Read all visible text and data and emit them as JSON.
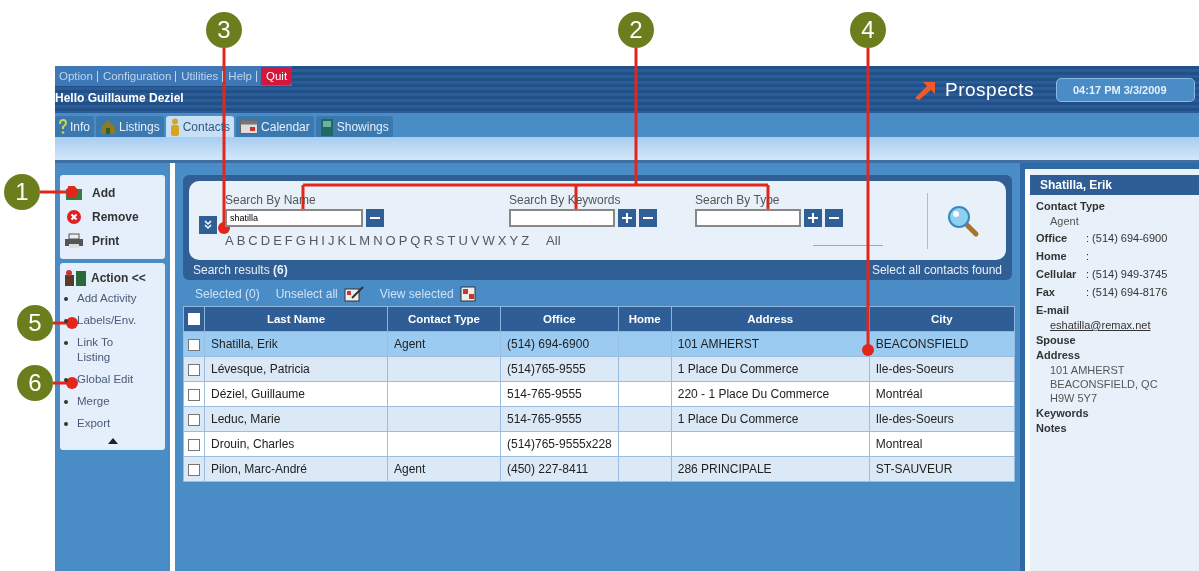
{
  "menu": [
    {
      "label": "Option",
      "kind": "link"
    },
    {
      "label": "Configuration",
      "kind": "link"
    },
    {
      "label": "Utilities",
      "kind": "link"
    },
    {
      "label": "Help",
      "kind": "link"
    },
    {
      "label": "Quit",
      "kind": "quit"
    }
  ],
  "greeting": "Hello Guillaume Deziel",
  "logo": "Prospects",
  "datetime": "04:17 PM 3/3/2009",
  "tabs": [
    {
      "label": "Info",
      "selected": false
    },
    {
      "label": "Listings",
      "selected": false
    },
    {
      "label": "Contacts",
      "selected": true
    },
    {
      "label": "Calendar",
      "selected": false
    },
    {
      "label": "Showings",
      "selected": false
    }
  ],
  "quick_actions": [
    {
      "label": "Add"
    },
    {
      "label": "Remove"
    },
    {
      "label": "Print"
    }
  ],
  "action_header": "Action <<",
  "action_items": [
    "Add Activity",
    "Labels/Env.",
    "Link To Listing",
    "Global Edit",
    "Merge",
    "Export"
  ],
  "search": {
    "name_label": "Search By Name",
    "name_value": "shatilla",
    "keywords_label": "Search By Keywords",
    "type_label": "Search By Type",
    "letters": [
      "A",
      "B",
      "C",
      "D",
      "E",
      "F",
      "G",
      "H",
      "I",
      "J",
      "K",
      "L",
      "M",
      "N",
      "O",
      "P",
      "Q",
      "R",
      "S",
      "T",
      "U",
      "V",
      "W",
      "X",
      "Y",
      "Z"
    ],
    "all": "All",
    "results": "Search results **(6)**",
    "select_all": "Select all contacts found"
  },
  "selection": {
    "selected": "Selected (0)",
    "unselect": "Unselect all",
    "view": "View selected"
  },
  "table": {
    "select_all_checked": false,
    "columns": [
      "Last Name",
      "Contact Type",
      "Office",
      "Home",
      "Address",
      "City"
    ],
    "rows": [
      {
        "checked": false,
        "selected": true,
        "cells": [
          "Shatilla, Erik",
          "Agent",
          "(514) 694-6900",
          "",
          "101 AMHERST",
          "BEACONSFIELD"
        ]
      },
      {
        "checked": false,
        "selected": false,
        "cells": [
          "Lévesque, Patricia",
          "",
          "(514)765-9555",
          "",
          "1 Place Du Commerce",
          "Ile-des-Soeurs"
        ]
      },
      {
        "checked": false,
        "selected": false,
        "cells": [
          "Déziel, Guillaume",
          "",
          "514-765-9555",
          "",
          "220 - 1 Place Du Commerce",
          "Montréal"
        ]
      },
      {
        "checked": false,
        "selected": false,
        "cells": [
          "Leduc, Marie",
          "",
          "514-765-9555",
          "",
          "1 Place Du Commerce",
          "Ile-des-Soeurs"
        ]
      },
      {
        "checked": false,
        "selected": false,
        "cells": [
          "Drouin, Charles",
          "",
          "(514)765-9555x228",
          "",
          "",
          "Montreal"
        ]
      },
      {
        "checked": false,
        "selected": false,
        "cells": [
          "Pilon, Marc-André",
          "Agent",
          "(450) 227-8411",
          "",
          "286 PRINCIPALE",
          "ST-SAUVEUR"
        ]
      }
    ]
  },
  "detail": {
    "title": "Shatilla, Erik",
    "fields": [
      {
        "kind": "heading",
        "label": "Contact Type"
      },
      {
        "kind": "value",
        "text": "Agent"
      },
      {
        "kind": "pair",
        "label": "Office",
        "text": ": (514) 694-6900"
      },
      {
        "kind": "pair",
        "label": "Home",
        "text": ":"
      },
      {
        "kind": "pair",
        "label": "Cellular",
        "text": ": (514) 949-3745"
      },
      {
        "kind": "pair",
        "label": "Fax",
        "text": ": (514) 694-8176"
      },
      {
        "kind": "heading",
        "label": "E-mail"
      },
      {
        "kind": "link",
        "text": "eshatilla@remax.net"
      },
      {
        "kind": "heading",
        "label": "Spouse"
      },
      {
        "kind": "heading",
        "label": "Address"
      },
      {
        "kind": "value",
        "text": "101 AMHERST"
      },
      {
        "kind": "value",
        "text": "BEACONSFIELD, QC"
      },
      {
        "kind": "value",
        "text": "H9W 5Y7"
      },
      {
        "kind": "heading",
        "label": "Keywords"
      },
      {
        "kind": "heading",
        "label": "Notes"
      }
    ]
  },
  "callouts": [
    {
      "number": "3"
    },
    {
      "number": "2"
    },
    {
      "number": "4"
    },
    {
      "number": "1"
    },
    {
      "number": "5"
    },
    {
      "number": "6"
    }
  ]
}
